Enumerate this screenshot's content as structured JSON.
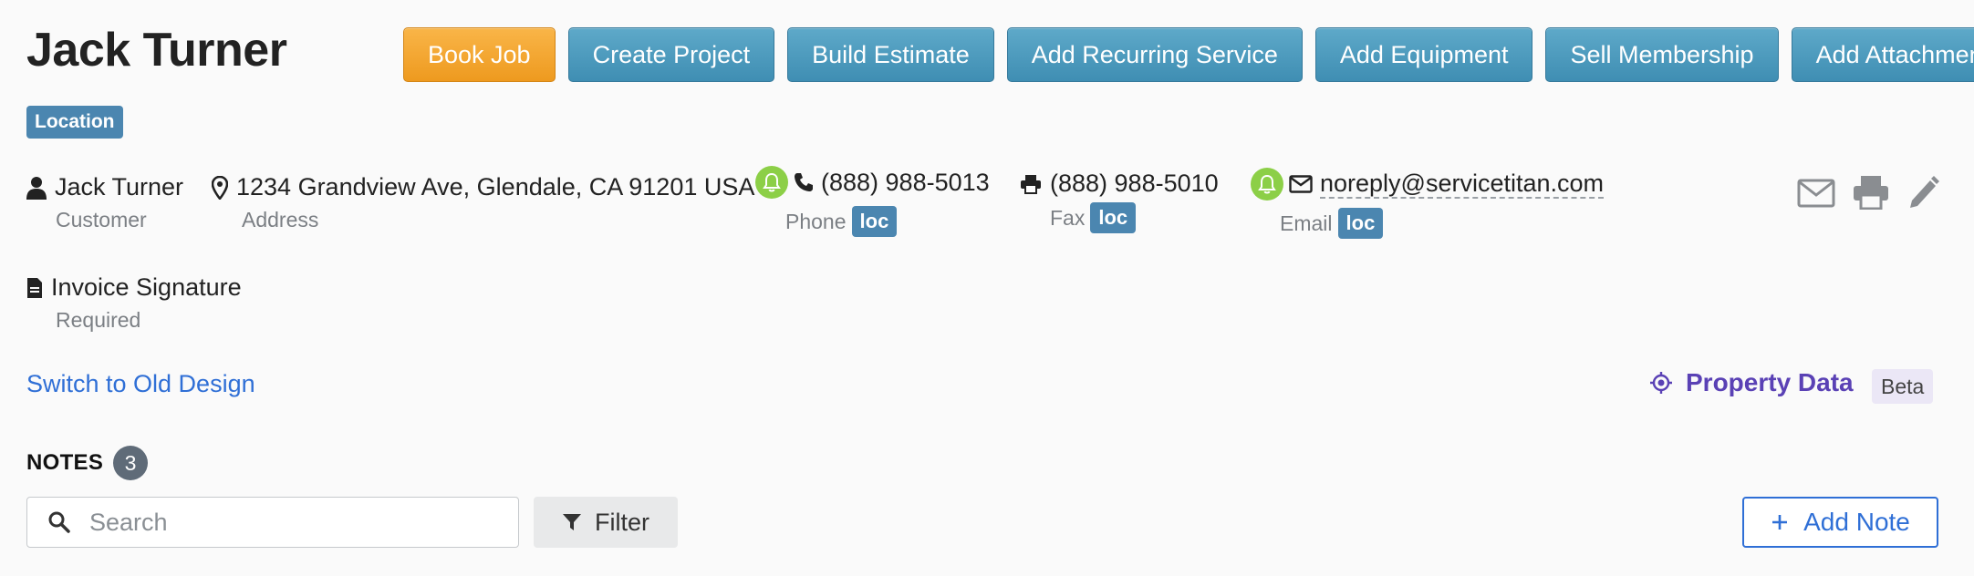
{
  "customer": {
    "name": "Jack Turner"
  },
  "actions": {
    "book_job": "Book Job",
    "create_project": "Create Project",
    "build_estimate": "Build Estimate",
    "add_recurring_service": "Add Recurring Service",
    "add_equipment": "Add Equipment",
    "sell_membership": "Sell Membership",
    "add_attachment": "Add Attachment"
  },
  "location_badge": "Location",
  "contact": {
    "name": {
      "value": "Jack Turner",
      "label": "Customer"
    },
    "address": {
      "value": "1234 Grandview Ave, Glendale, CA 91201 USA",
      "label": "Address"
    },
    "phone": {
      "value": "(888) 988-5013",
      "label": "Phone",
      "tag": "loc"
    },
    "fax": {
      "value": "(888) 988-5010",
      "label": "Fax",
      "tag": "loc"
    },
    "email": {
      "value": "noreply@servicetitan.com",
      "label": "Email",
      "tag": "loc"
    },
    "invoice_signature": {
      "value": "Invoice Signature",
      "label": "Required"
    }
  },
  "links": {
    "switch_design": "Switch to Old Design",
    "property_data": "Property Data",
    "property_beta": "Beta"
  },
  "notes": {
    "title": "NOTES",
    "count": "3",
    "search_placeholder": "Search",
    "filter_label": "Filter",
    "add_note_label": "Add Note"
  },
  "colors": {
    "button_blue": "#4a9bc0",
    "button_orange": "#f3a734",
    "tag_blue": "#4b86b0",
    "bell_green": "#8ccf47",
    "link_blue": "#2f6fd6",
    "property_purple": "#5a41b5"
  },
  "icons": {
    "person": "person-icon",
    "address": "map-pin-icon",
    "phone": "phone-icon",
    "fax": "printer-icon",
    "email": "envelope-icon",
    "notification": "bell-icon",
    "document": "document-icon",
    "property": "crosshair-icon",
    "search": "search-icon",
    "filter": "filter-icon",
    "add": "plus-icon",
    "edit": "pencil-icon"
  }
}
